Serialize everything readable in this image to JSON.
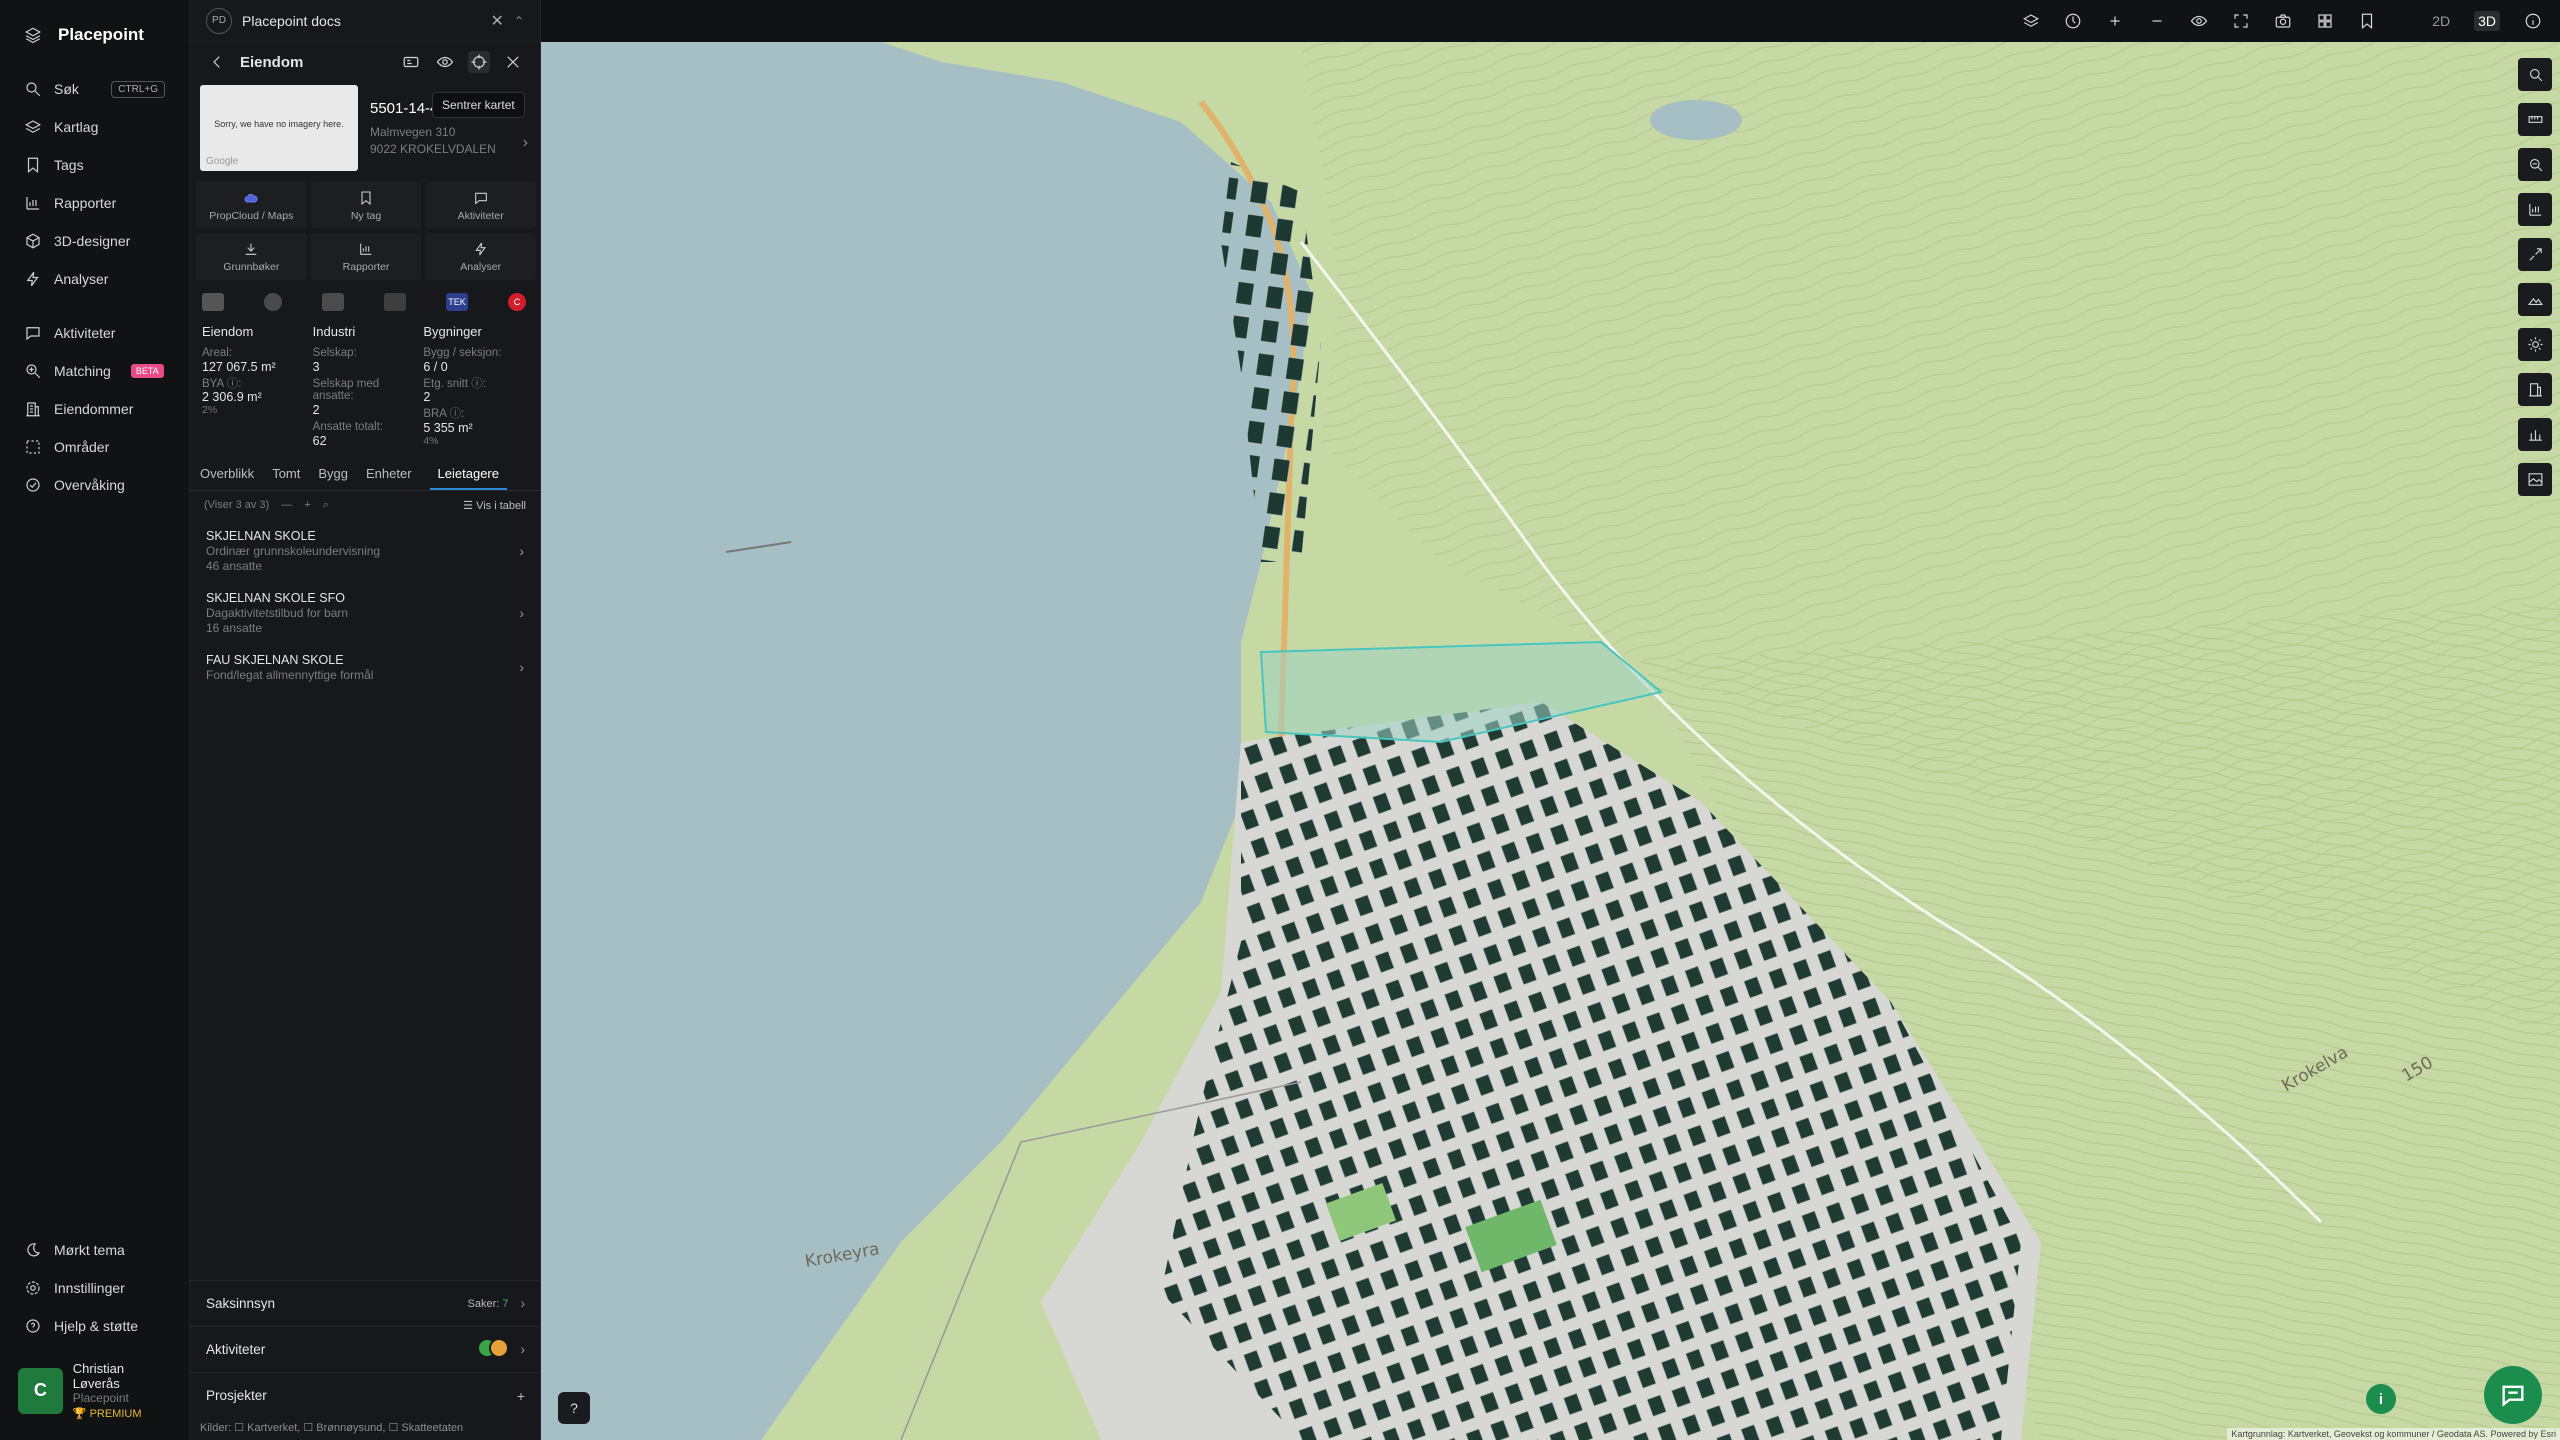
{
  "app": {
    "name": "Placepoint"
  },
  "sidebar": {
    "items": [
      {
        "label": "Søk",
        "shortcut": "CTRL+G"
      },
      {
        "label": "Kartlag"
      },
      {
        "label": "Tags"
      },
      {
        "label": "Rapporter"
      },
      {
        "label": "3D-designer"
      },
      {
        "label": "Analyser"
      },
      {
        "label": "Aktiviteter"
      },
      {
        "label": "Matching",
        "badge": "BETA"
      },
      {
        "label": "Eiendommer"
      },
      {
        "label": "Områder"
      },
      {
        "label": "Overvåking"
      }
    ],
    "bottom": [
      {
        "label": "Mørkt tema"
      },
      {
        "label": "Innstillinger"
      },
      {
        "label": "Hjelp & støtte"
      }
    ],
    "user": {
      "initial": "C",
      "name": "Christian Løverås",
      "org": "Placepoint",
      "plan": "PREMIUM"
    }
  },
  "panel": {
    "tab_title": "Placepoint docs",
    "tab_badge": "PD",
    "header": "Eiendom",
    "tooltip": "Sentrer kartet",
    "thumb_text": "Sorry, we have no imagery here.",
    "thumb_logo": "Google",
    "property": {
      "id": "5501-14-4/ 0-0",
      "address": "Malmvegen 310",
      "postal": "9022 KROKELVDALEN"
    },
    "actions": [
      "PropCloud / Maps",
      "Ny tag",
      "Aktiviteter",
      "Grunnbøker",
      "Rapporter",
      "Analyser"
    ],
    "source_badges": [
      "",
      "",
      "",
      "",
      "TEK",
      "C"
    ],
    "stats": {
      "eiendom": {
        "title": "Eiendom",
        "areal_label": "Areal:",
        "areal": "127 067.5 m²",
        "bya_label": "BYA ⓘ:",
        "bya": "2 306.9 m²",
        "bya_pct": "2%"
      },
      "industri": {
        "title": "Industri",
        "selskap_label": "Selskap:",
        "selskap": "3",
        "ansatte_label": "Selskap med ansatte:",
        "ansatte": "2",
        "total_label": "Ansatte totalt:",
        "total": "62"
      },
      "bygninger": {
        "title": "Bygninger",
        "bygg_label": "Bygg / seksjon:",
        "bygg": "6 / 0",
        "etg_label": "Etg. snitt ⓘ:",
        "etg": "2",
        "bra_label": "BRA ⓘ:",
        "bra": "5 355 m²",
        "bra_pct": "4%"
      }
    },
    "tabs": [
      "Overblikk",
      "Tomt",
      "Bygg",
      "Enheter",
      "Leietagere"
    ],
    "active_tab": 4,
    "list_count": "(Viser 3 av 3)",
    "list_table": "Vis i tabell",
    "tenants": [
      {
        "name": "SKJELNAN SKOLE",
        "desc": "Ordinær grunnskoleundervisning",
        "emp": "46 ansatte"
      },
      {
        "name": "SKJELNAN SKOLE SFO",
        "desc": "Dagaktivitetstilbud for barn",
        "emp": "16 ansatte"
      },
      {
        "name": "FAU SKJELNAN SKOLE",
        "desc": "Fond/legat allmennyttige formål",
        "emp": ""
      }
    ],
    "sections": [
      {
        "label": "Saksinnsyn",
        "meta_label": "Saker:",
        "meta_value": "7"
      },
      {
        "label": "Aktiviteter"
      },
      {
        "label": "Prosjekter"
      }
    ],
    "sources": "Kilder: ☐ Kartverket, ☐ Brønnøysund, ☐ Skatteetaten"
  },
  "topbar": {
    "mode_2d": "2D",
    "mode_3d": "3D"
  },
  "map": {
    "labels": [
      "Krokeyra",
      "Krokelva",
      "150"
    ],
    "attribution": "Kartgrunnlag: Kartverket, Geovekst og kommuner / Geodata AS. Powered by Esri"
  },
  "colors": {
    "accent": "#1b8e4d",
    "tab_active": "#2f8bd9",
    "beta": "#e84a8a",
    "premium": "#e7b63a"
  }
}
